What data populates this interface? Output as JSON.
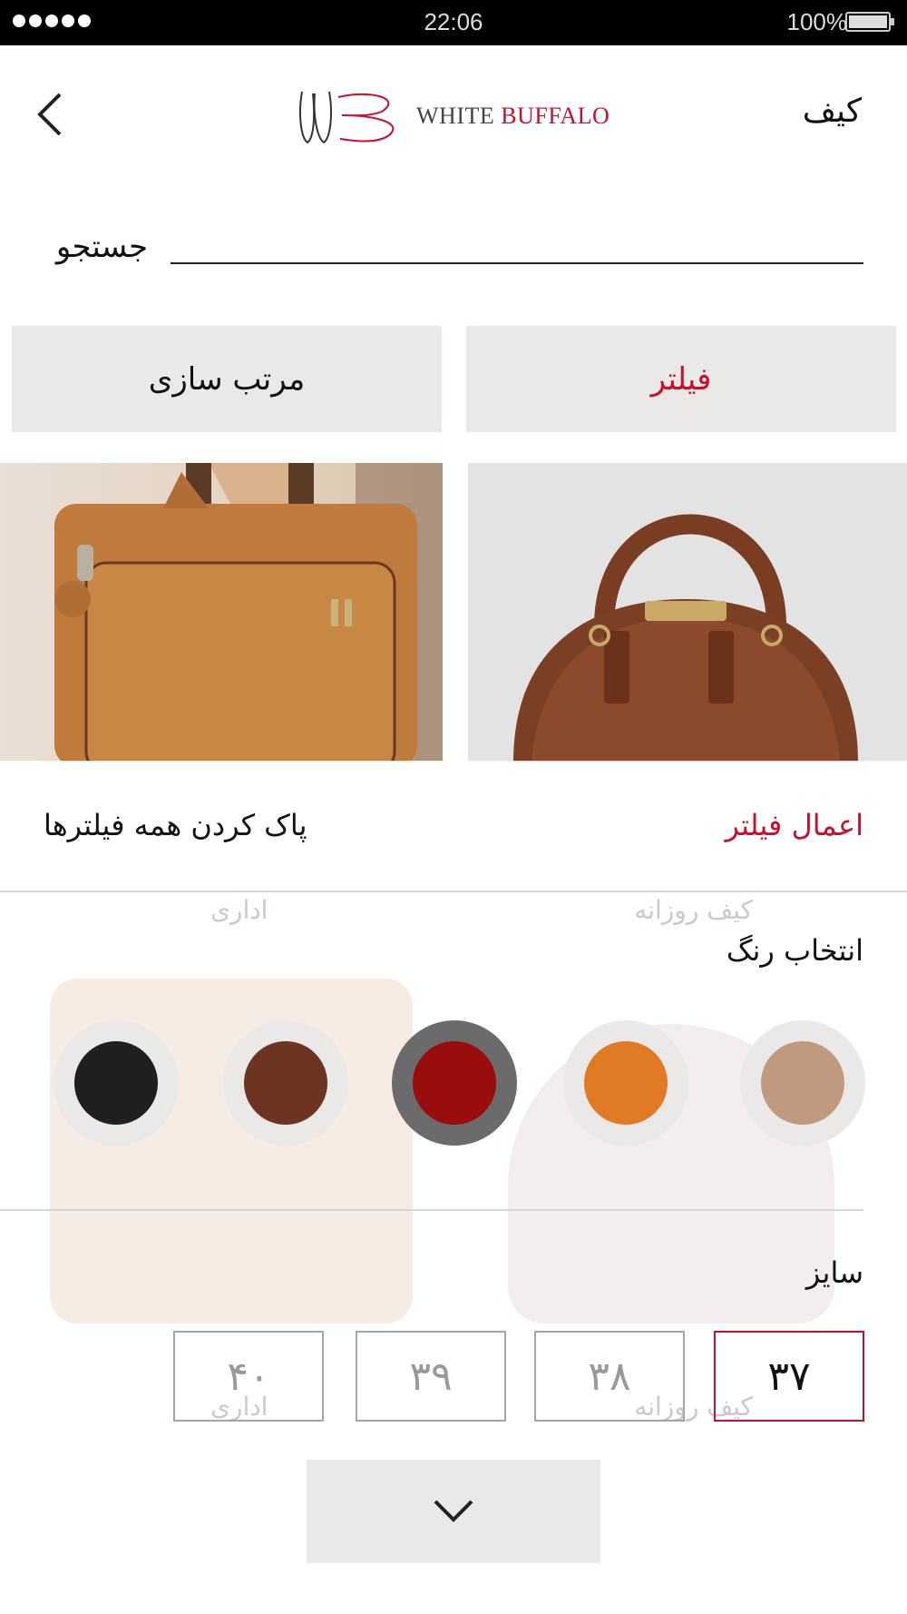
{
  "status_bar": {
    "time": "22:06",
    "battery_text": "100%"
  },
  "header": {
    "title": "کیف",
    "logo": {
      "word1": "WHITE",
      "word2": "BUFFALO"
    },
    "back_icon": "chevron-left-icon"
  },
  "search": {
    "label": "جستجو"
  },
  "toolbar": {
    "filter_label": "فیلتر",
    "sort_label": "مرتب سازی"
  },
  "filter_panel": {
    "apply_label": "اعمال فیلتر",
    "clear_label": "پاک کردن همه فیلترها",
    "color_section_title": "انتخاب رنگ",
    "colors": [
      {
        "name": "beige",
        "hex": "#bf9a7f",
        "selected": false
      },
      {
        "name": "orange",
        "hex": "#e07a24",
        "selected": false
      },
      {
        "name": "red",
        "hex": "#9a0d0d",
        "selected": true
      },
      {
        "name": "brown",
        "hex": "#6e3422",
        "selected": false
      },
      {
        "name": "black",
        "hex": "#1f1f1f",
        "selected": false
      }
    ],
    "size_section_title": "سایز",
    "sizes": [
      {
        "label": "۳۷",
        "selected": true
      },
      {
        "label": "۳۸",
        "selected": false
      },
      {
        "label": "۳۹",
        "selected": false
      },
      {
        "label": "۴۰",
        "selected": false
      }
    ],
    "collapse_icon": "chevron-down-icon"
  },
  "background_products": {
    "row1_right_label": "کیف روزانه",
    "row1_left_label": "اداری",
    "row2_right_label": "کیف روزانه",
    "row2_left_label": "اداری"
  },
  "colors": {
    "accent": "#c8102e",
    "button_bg": "#ebe8e8",
    "selected_ring": "#6b6b6b"
  }
}
